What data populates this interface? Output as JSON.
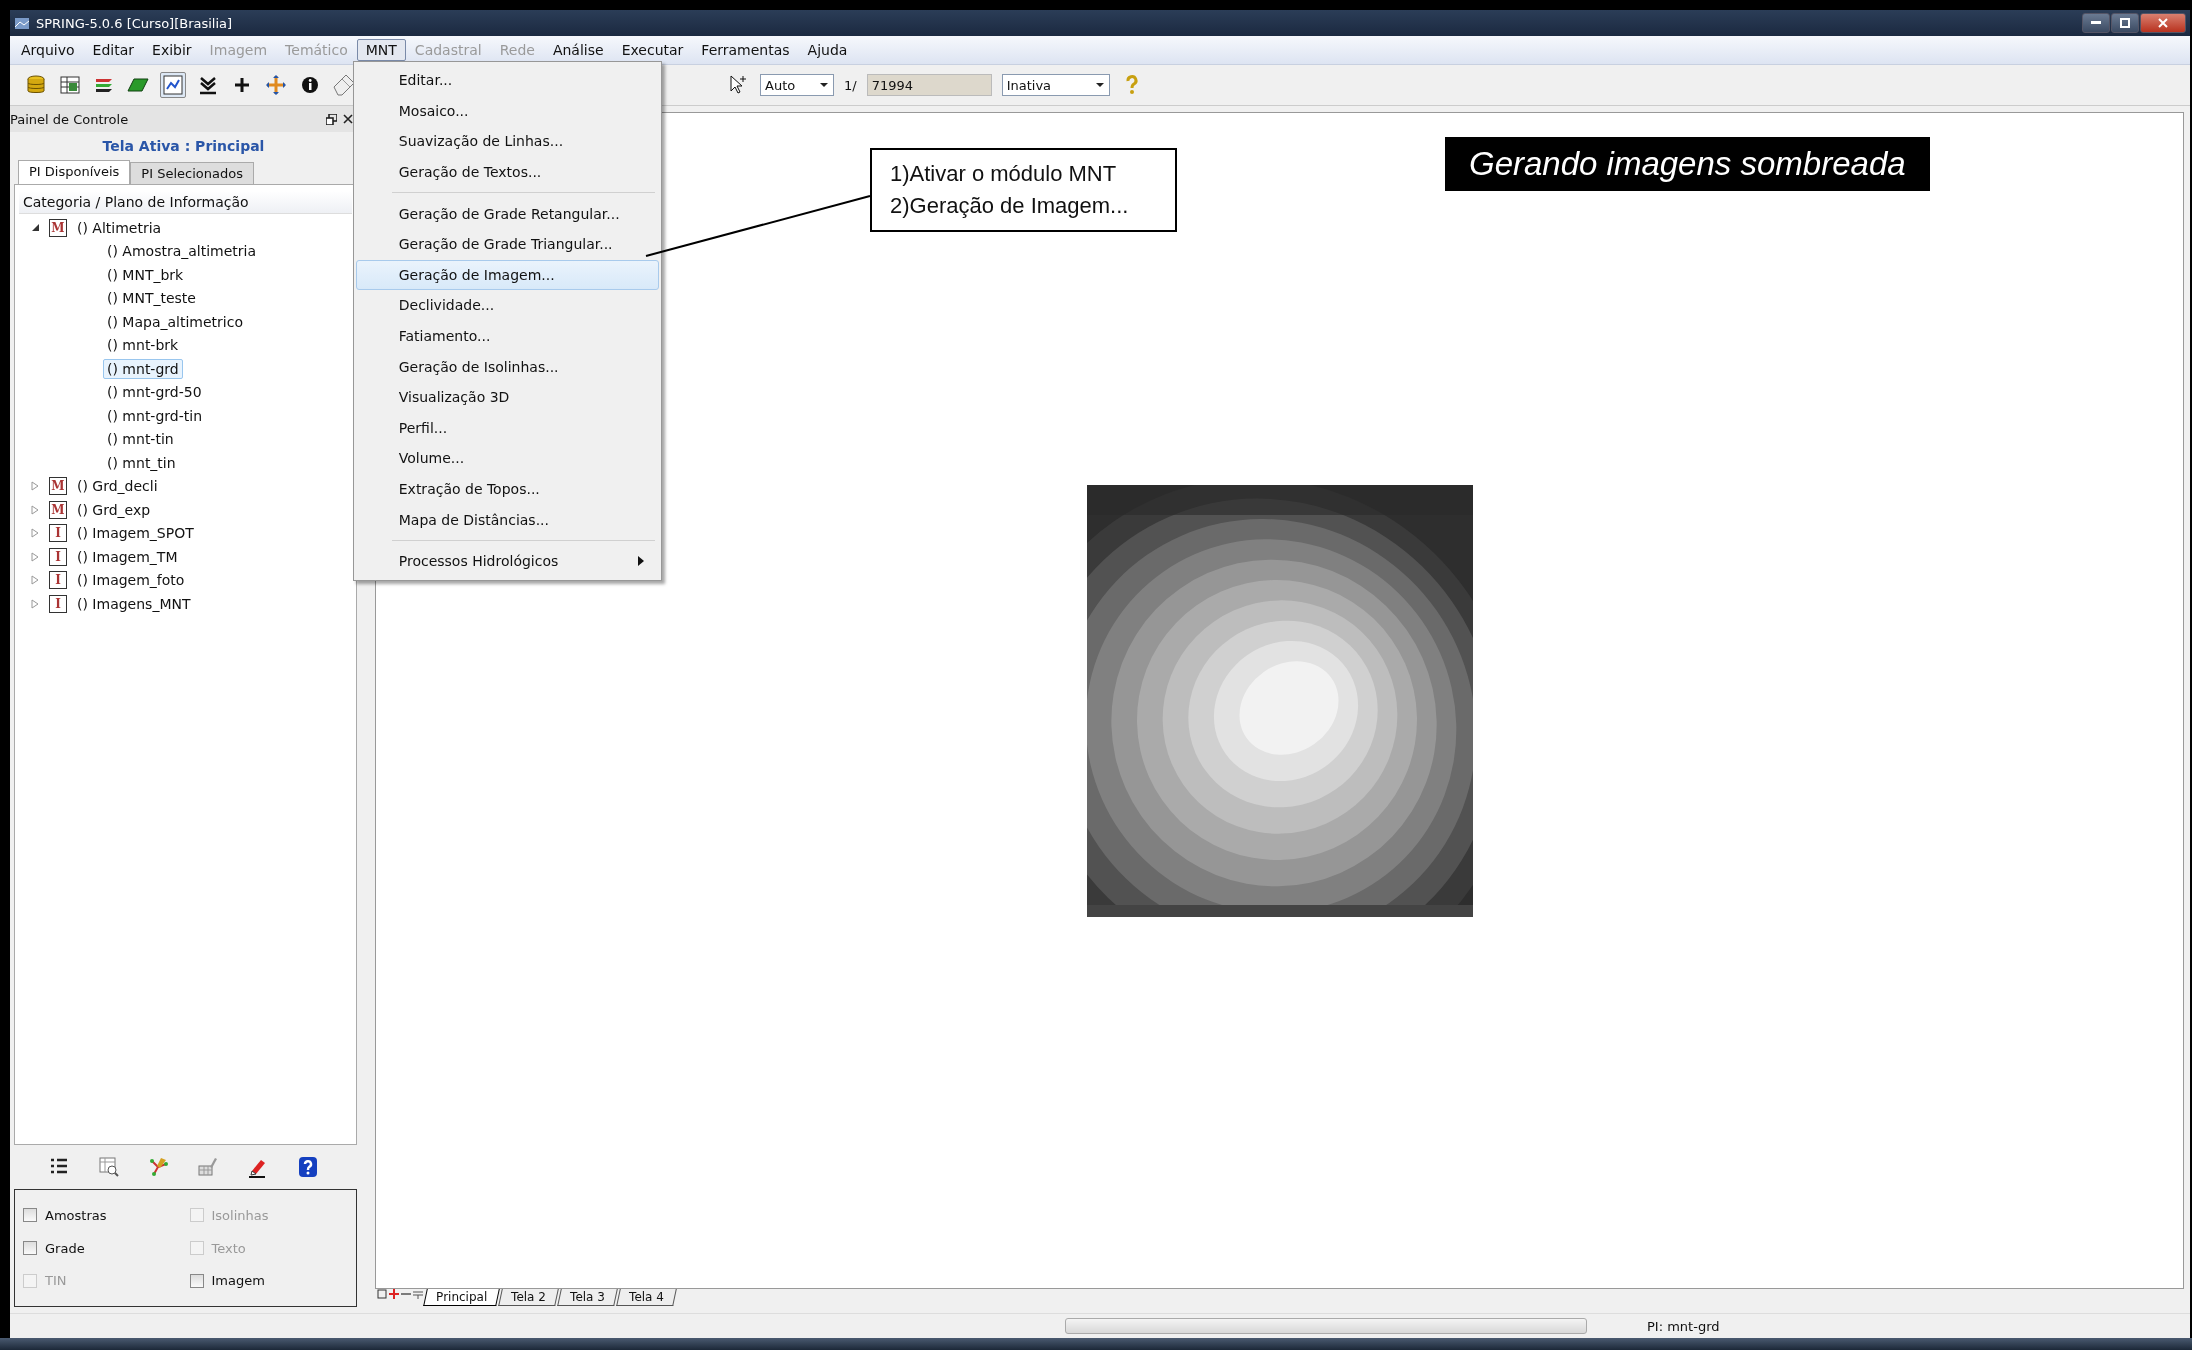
{
  "window": {
    "title": "SPRING-5.0.6 [Curso][Brasilia]"
  },
  "menu_bar": [
    {
      "label": "Arquivo",
      "disabled": false,
      "selected": false
    },
    {
      "label": "Editar",
      "disabled": false,
      "selected": false
    },
    {
      "label": "Exibir",
      "disabled": false,
      "selected": false
    },
    {
      "label": "Imagem",
      "disabled": true,
      "selected": false
    },
    {
      "label": "Temático",
      "disabled": true,
      "selected": false
    },
    {
      "label": "MNT",
      "disabled": false,
      "selected": true
    },
    {
      "label": "Cadastral",
      "disabled": true,
      "selected": false
    },
    {
      "label": "Rede",
      "disabled": true,
      "selected": false
    },
    {
      "label": "Análise",
      "disabled": false,
      "selected": false
    },
    {
      "label": "Executar",
      "disabled": false,
      "selected": false
    },
    {
      "label": "Ferramentas",
      "disabled": false,
      "selected": false
    },
    {
      "label": "Ajuda",
      "disabled": false,
      "selected": false
    }
  ],
  "open_menu": {
    "items": [
      {
        "kind": "item",
        "label": "Editar...",
        "selected": false
      },
      {
        "kind": "item",
        "label": "Mosaico...",
        "selected": false
      },
      {
        "kind": "item",
        "label": "Suavização de Linhas...",
        "selected": false
      },
      {
        "kind": "item",
        "label": "Geração de Textos...",
        "selected": false
      },
      {
        "kind": "separator"
      },
      {
        "kind": "item",
        "label": "Geração de Grade Retangular...",
        "selected": false
      },
      {
        "kind": "item",
        "label": "Geração de Grade Triangular...",
        "selected": false
      },
      {
        "kind": "item",
        "label": "Geração de Imagem...",
        "selected": true
      },
      {
        "kind": "item",
        "label": "Declividade...",
        "selected": false
      },
      {
        "kind": "item",
        "label": "Fatiamento...",
        "selected": false
      },
      {
        "kind": "item",
        "label": "Geração de Isolinhas...",
        "selected": false
      },
      {
        "kind": "item",
        "label": "Visualização 3D",
        "selected": false
      },
      {
        "kind": "item",
        "label": "Perfil...",
        "selected": false
      },
      {
        "kind": "item",
        "label": "Volume...",
        "selected": false
      },
      {
        "kind": "item",
        "label": "Extração de Topos...",
        "selected": false
      },
      {
        "kind": "item",
        "label": "Mapa de Distâncias...",
        "selected": false
      },
      {
        "kind": "separator"
      },
      {
        "kind": "submenu",
        "label": "Processos Hidrológicos",
        "selected": false
      }
    ]
  },
  "toolbar": {
    "scale_mode": "Auto",
    "scale_prefix": "1/",
    "scale_value": "71994",
    "mode": "Inativa"
  },
  "control_panel": {
    "title": "Painel de Controle",
    "active_screen": "Tela Ativa : Principal",
    "tabs": [
      {
        "label": "PI Disponíveis",
        "selected": true
      },
      {
        "label": "PI Selecionados",
        "selected": false
      }
    ],
    "tree_header": "Categoria / Plano de Informação",
    "tree": [
      {
        "tag": "M",
        "label": "() Altimetria",
        "expanded": true,
        "selected": false,
        "children": [
          {
            "label": "() Amostra_altimetria",
            "selected": false
          },
          {
            "label": "() MNT_brk",
            "selected": false
          },
          {
            "label": "() MNT_teste",
            "selected": false
          },
          {
            "label": "() Mapa_altimetrico",
            "selected": false
          },
          {
            "label": "() mnt-brk",
            "selected": false
          },
          {
            "label": "() mnt-grd",
            "selected": true
          },
          {
            "label": "() mnt-grd-50",
            "selected": false
          },
          {
            "label": "() mnt-grd-tin",
            "selected": false
          },
          {
            "label": "() mnt-tin",
            "selected": false
          },
          {
            "label": "() mnt_tin",
            "selected": false
          }
        ]
      },
      {
        "tag": "M",
        "label": "() Grd_decli",
        "expanded": false,
        "selected": false
      },
      {
        "tag": "M",
        "label": "() Grd_exp",
        "expanded": false,
        "selected": false
      },
      {
        "tag": "I",
        "label": "() Imagem_SPOT",
        "expanded": false,
        "selected": false
      },
      {
        "tag": "I",
        "label": "() Imagem_TM",
        "expanded": false,
        "selected": false
      },
      {
        "tag": "I",
        "label": "() Imagem_foto",
        "expanded": false,
        "selected": false
      },
      {
        "tag": "I",
        "label": "() Imagens_MNT",
        "expanded": false,
        "selected": false
      }
    ],
    "layers": [
      {
        "label": "Amostras",
        "checked": false,
        "disabled": false
      },
      {
        "label": "Isolinhas",
        "checked": false,
        "disabled": true
      },
      {
        "label": "Grade",
        "checked": false,
        "disabled": false
      },
      {
        "label": "Texto",
        "checked": false,
        "disabled": true
      },
      {
        "label": "TIN",
        "checked": false,
        "disabled": true
      },
      {
        "label": "Imagem",
        "checked": false,
        "disabled": false
      }
    ]
  },
  "screen_tabs": [
    {
      "label": "Principal",
      "selected": true
    },
    {
      "label": "Tela 2",
      "selected": false
    },
    {
      "label": "Tela 3",
      "selected": false
    },
    {
      "label": "Tela 4",
      "selected": false
    }
  ],
  "status_bar": {
    "text": "PI: mnt-grd"
  },
  "annotations": {
    "callout": [
      "1)Ativar o módulo MNT",
      "2)Geração de Imagem..."
    ],
    "title": "Gerando imagens sombreada"
  }
}
